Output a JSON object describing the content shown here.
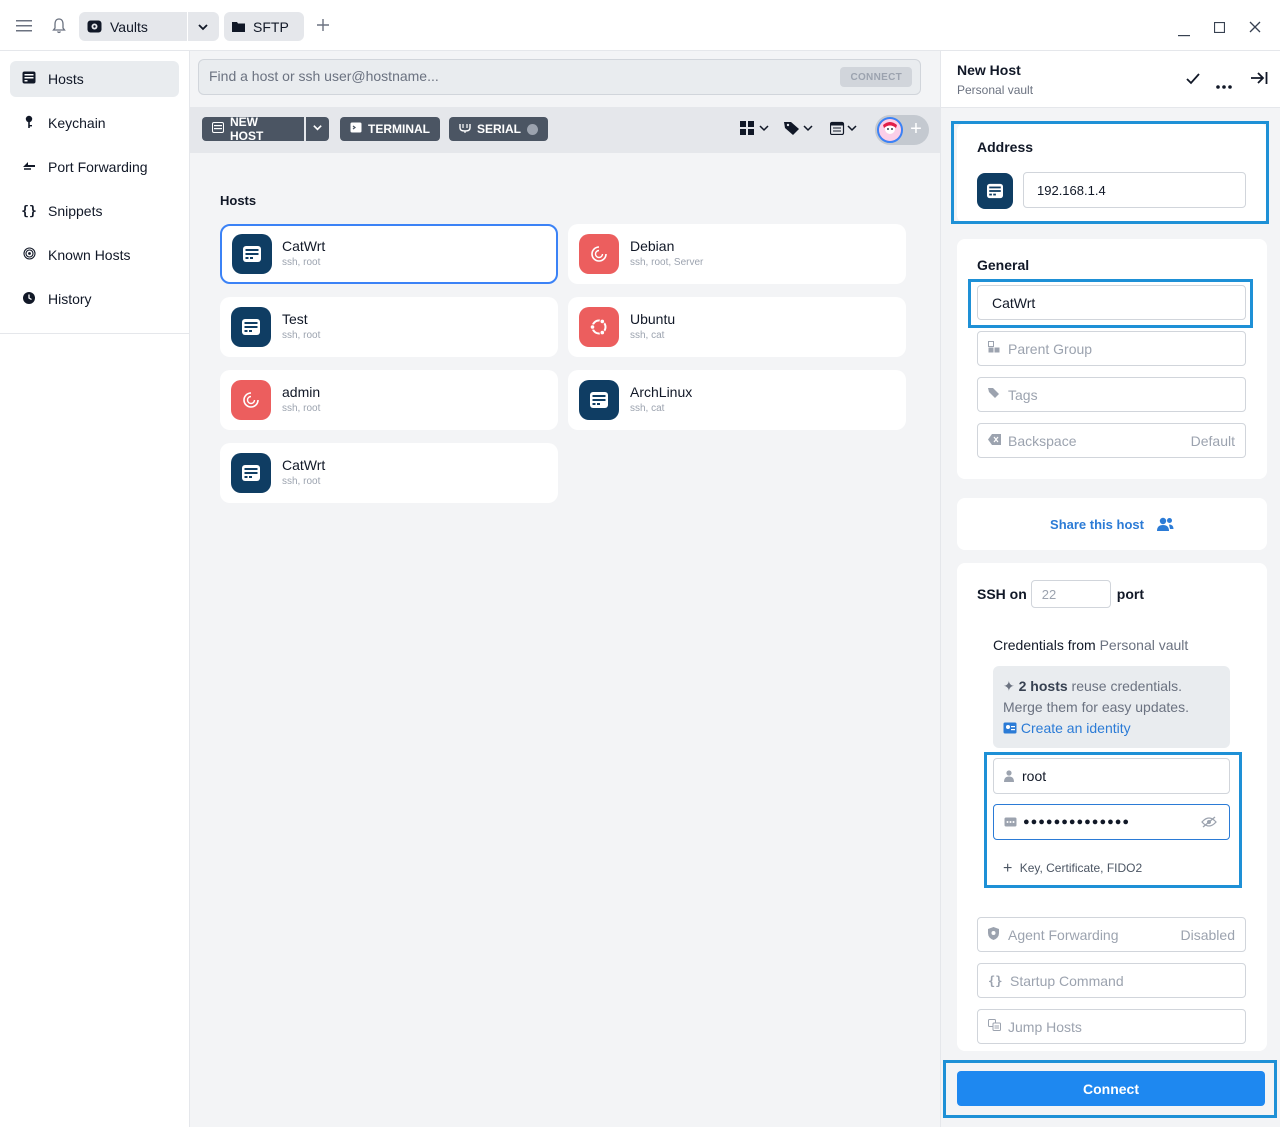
{
  "titlebar": {
    "vault_label": "Vaults",
    "sftp_label": "SFTP"
  },
  "sidebar": {
    "items": [
      {
        "label": "Hosts",
        "icon": "hosts-icon"
      },
      {
        "label": "Keychain",
        "icon": "key-icon"
      },
      {
        "label": "Port Forwarding",
        "icon": "port-forwarding-icon"
      },
      {
        "label": "Snippets",
        "icon": "braces-icon"
      },
      {
        "label": "Known Hosts",
        "icon": "fingerprint-icon"
      },
      {
        "label": "History",
        "icon": "history-icon"
      }
    ]
  },
  "search": {
    "placeholder": "Find a host or ssh user@hostname...",
    "connect_label": "CONNECT"
  },
  "toolbar": {
    "new_host_label": "NEW HOST",
    "terminal_label": "TERMINAL",
    "serial_label": "SERIAL"
  },
  "hosts_section": {
    "title": "Hosts",
    "hosts": [
      {
        "name": "CatWrt",
        "sub": "ssh, root",
        "icon": "server-icon",
        "color": "#0f3d63"
      },
      {
        "name": "Debian",
        "sub": "ssh, root, Server",
        "icon": "debian-icon",
        "color": "#ec5e5e"
      },
      {
        "name": "Test",
        "sub": "ssh, root",
        "icon": "server-icon",
        "color": "#0f3d63"
      },
      {
        "name": "Ubuntu",
        "sub": "ssh, cat",
        "icon": "ubuntu-icon",
        "color": "#ec5e5e"
      },
      {
        "name": "admin",
        "sub": "ssh, root",
        "icon": "debian-icon",
        "color": "#ec5e5e"
      },
      {
        "name": "ArchLinux",
        "sub": "ssh, cat",
        "icon": "server-icon",
        "color": "#0f3d63"
      },
      {
        "name": "CatWrt",
        "sub": "ssh, root",
        "icon": "server-icon",
        "color": "#0f3d63"
      }
    ]
  },
  "panel": {
    "title": "New Host",
    "subtitle": "Personal vault",
    "address_label": "Address",
    "address_value": "192.168.1.4",
    "general_label": "General",
    "label_value": "CatWrt",
    "parent_group": "Parent Group",
    "tags": "Tags",
    "backspace_label": "Backspace",
    "backspace_value": "Default",
    "share_label": "Share this host",
    "ssh_on": "SSH on",
    "port_placeholder": "22",
    "port_label": "port",
    "credentials_from": "Credentials from",
    "credentials_vault": "Personal vault",
    "merge_count": "2 hosts",
    "merge_text1": "reuse credentials.",
    "merge_text2": "Merge them for easy updates.",
    "create_identity": "Create an identity",
    "username": "root",
    "password_mask": "●●●●●●●●●●●●●●",
    "key_option": "Key, Certificate, FIDO2",
    "agent_forwarding_label": "Agent Forwarding",
    "agent_forwarding_value": "Disabled",
    "startup_command": "Startup Command",
    "jump_hosts": "Jump Hosts",
    "connect_label": "Connect"
  },
  "colors": {
    "accent": "#1e88f0",
    "highlight": "#1e90d6",
    "host_blue": "#0f3d63",
    "host_red": "#ec5e5e"
  }
}
